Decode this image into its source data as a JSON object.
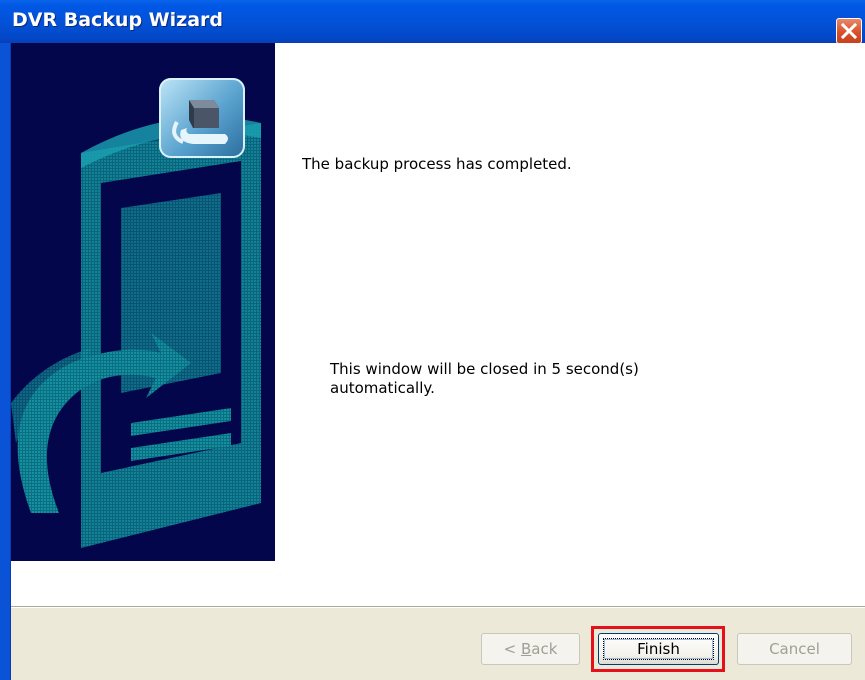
{
  "window": {
    "title": "DVR Backup Wizard"
  },
  "icons": {
    "close": "close-icon",
    "backup": "backup-drive-icon",
    "banner": "banner-graphic"
  },
  "content": {
    "message": "The backup process has completed.",
    "auto_close_line1": "This window will be closed in 5 second(s)",
    "auto_close_line2": "automatically."
  },
  "buttons": {
    "back_prefix": "< ",
    "back_accel": "B",
    "back_rest": "ack",
    "finish": "Finish",
    "cancel": "Cancel",
    "back_enabled": false,
    "cancel_enabled": false
  },
  "colors": {
    "titlebar": "#0352d8",
    "banner_bg": "#03064a",
    "banner_art": "#0d7d8c",
    "footer_bg": "#ece9d8",
    "highlight": "#e5101a"
  }
}
